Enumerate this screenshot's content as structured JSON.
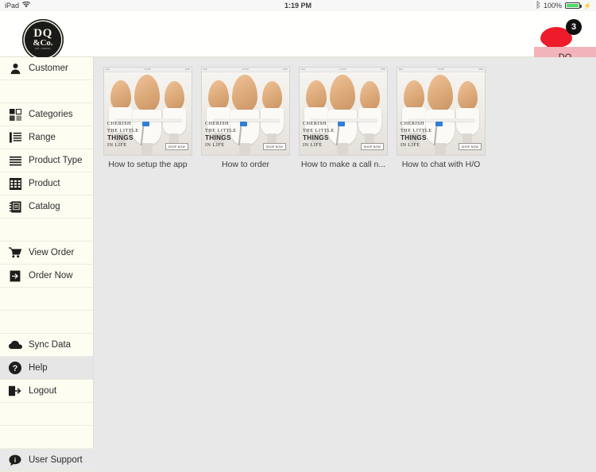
{
  "status_bar": {
    "device": "iPad",
    "wifi_icon": "wifi-icon",
    "time": "1:19 PM",
    "bluetooth_icon": "bluetooth-icon",
    "battery_percent": "100%",
    "battery_icon": "battery-icon",
    "battery_color": "#4cd964"
  },
  "header": {
    "logo": {
      "line1": "DQ",
      "line2": "&Co.",
      "line3": "EST. LONDON"
    },
    "chat": {
      "icon": "chat-bubble-icon",
      "badge_count": "3",
      "bubble_color": "#ee1c2a"
    },
    "account_button": {
      "label": "DQ",
      "color": "#f2b3ba"
    }
  },
  "sidebar": {
    "items": [
      {
        "label": "Customer",
        "icon": "person-icon",
        "selected": false
      },
      {
        "label": "",
        "icon": "",
        "selected": false
      },
      {
        "label": "Categories",
        "icon": "grid-squares-icon",
        "selected": false
      },
      {
        "label": "Range",
        "icon": "list-icon",
        "selected": false
      },
      {
        "label": "Product Type",
        "icon": "lines-icon",
        "selected": false
      },
      {
        "label": "Product",
        "icon": "table-grid-icon",
        "selected": false
      },
      {
        "label": "Catalog",
        "icon": "notebook-icon",
        "selected": false
      },
      {
        "label": "",
        "icon": "",
        "selected": false
      },
      {
        "label": "View Order",
        "icon": "cart-icon",
        "selected": false
      },
      {
        "label": "Order Now",
        "icon": "arrow-in-box-icon",
        "selected": false
      },
      {
        "label": "",
        "icon": "",
        "selected": false
      },
      {
        "label": "Sync Data",
        "icon": "cloud-icon",
        "selected": false
      },
      {
        "label": "Help",
        "icon": "question-mark-icon",
        "selected": true
      },
      {
        "label": "Logout",
        "icon": "logout-icon",
        "selected": false
      },
      {
        "label": "",
        "icon": "",
        "selected": false
      },
      {
        "label": "User Support",
        "icon": "info-bubble-icon",
        "selected": false
      }
    ]
  },
  "main": {
    "help_items": [
      {
        "caption": "How to setup the app"
      },
      {
        "caption": "How to order"
      },
      {
        "caption": "How to make a call n..."
      },
      {
        "caption": "How to chat with H/O"
      }
    ],
    "thumbnail_art": {
      "line1": "CHERISH",
      "line2": "THE LITTLE",
      "line3": "THINGS",
      "line4": "IN LIFE",
      "cta": "SHOP NOW"
    }
  }
}
